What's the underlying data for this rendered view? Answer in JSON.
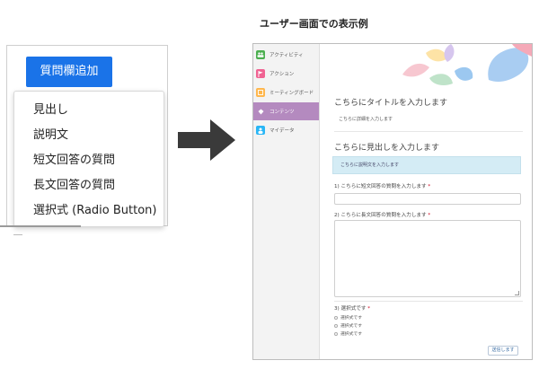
{
  "caption": "ユーザー画面での表示例",
  "left": {
    "add_button": "質問欄追加",
    "menu_items": [
      "見出し",
      "説明文",
      "短文回答の質問",
      "長文回答の質問",
      "選択式 (Radio Button)"
    ]
  },
  "sidebar": {
    "items": [
      {
        "label": "アクティビティ",
        "icon": "people-icon",
        "color": "#4caf50"
      },
      {
        "label": "アクション",
        "icon": "flag-icon",
        "color": "#f06292"
      },
      {
        "label": "ミーティングボード",
        "icon": "board-icon",
        "color": "#ffb74d"
      },
      {
        "label": "コンテンツ",
        "icon": "content-icon",
        "color": "#b48abf"
      },
      {
        "label": "マイデータ",
        "icon": "person-icon",
        "color": "#29b6f6"
      }
    ],
    "active_index": 3
  },
  "form": {
    "title": "こちらにタイトルを入力します",
    "description": "こちらに詳細を入力します",
    "heading": "こちらに見出しを入力します",
    "info_text": "こちらに説明文を入力します",
    "q1": "1) こちらに短文回答の質問を入力します",
    "q2": "2) こちらに長文回答の質問を入力します",
    "q3": "3) 選択式です",
    "required_mark": "*",
    "options": [
      "選択式です",
      "選択式です",
      "選択式です"
    ],
    "submit": "送信します"
  },
  "colors": {
    "button": "#1a73e8",
    "active_sidebar": "#b48abf",
    "info_box": "#d4ecf5",
    "arrow": "#3a3a3a"
  }
}
